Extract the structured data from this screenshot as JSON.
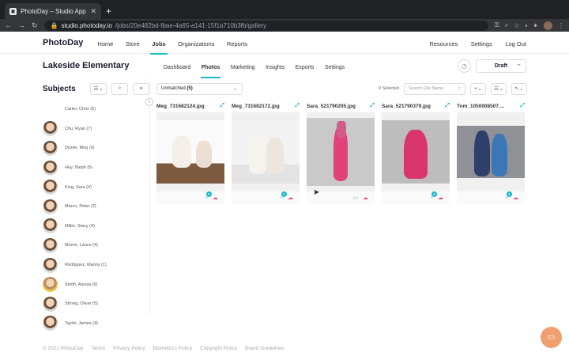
{
  "browser": {
    "tab_title": "PhotoDay – Studio App",
    "url_host": "studio.photoday.io",
    "url_path": "/jobs/20e482bd-fbae-4a65-a141-15f1a710b3fb/gallery"
  },
  "app": {
    "logo": "PhotoDay",
    "nav": [
      "Home",
      "Store",
      "Jobs",
      "Organizations",
      "Reports"
    ],
    "nav_right": [
      "Resources",
      "Settings",
      "Log Out"
    ]
  },
  "job": {
    "title": "Lakeside Elementary",
    "tabs": [
      "Dashboard",
      "Photos",
      "Marketing",
      "Insights",
      "Exports",
      "Settings"
    ],
    "status": "Draft"
  },
  "sidebar": {
    "title": "Subjects",
    "subjects": [
      "Carter, Chris (5)",
      "Chu, Ryan (7)",
      "Dozier, Meg (6)",
      "Huy, Steph (5)",
      "King, Sara (4)",
      "Marco, Peter (2)",
      "Miller, Stacy (4)",
      "Moore, Lance (4)",
      "Rodriguez, Manny (1)",
      "Smith, Alyssa (9)",
      "Strong, Oliver (5)",
      "Taylor, James (4)"
    ]
  },
  "toolbar": {
    "filter_label": "Unmatched",
    "filter_count": "(5)",
    "selected": "0 Selected",
    "search_placeholder": "Search File Name"
  },
  "photos": [
    {
      "filename": "Meg_731682124.jpg",
      "tag_count": "1"
    },
    {
      "filename": "Meg_731682172.jpg",
      "tag_count": "1"
    },
    {
      "filename": "Sara_521790205.jpg",
      "tag_count": ""
    },
    {
      "filename": "Sara_521790379.jpg",
      "tag_count": "1"
    },
    {
      "filename": "Tom_1050008507....",
      "tag_count": "1"
    }
  ],
  "footer": [
    "© 2021 PhotoDay",
    "Terms",
    "Privacy Policy",
    "Biometrics Policy",
    "Copyright Policy",
    "Brand Guidelines"
  ],
  "colors": {
    "accent": "#1bb6c9",
    "cloud": "#e0557a",
    "chat": "#f0a070"
  }
}
